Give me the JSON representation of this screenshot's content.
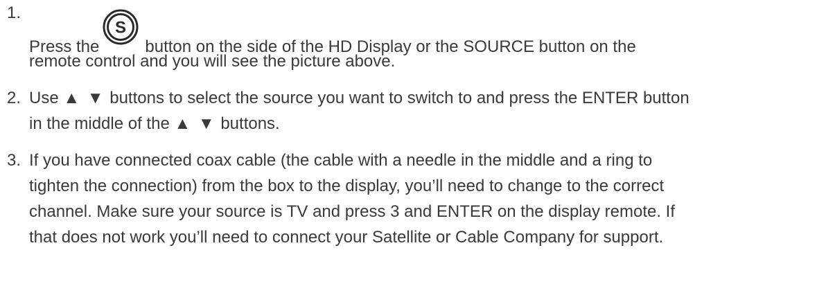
{
  "steps": [
    {
      "number": "1.",
      "line1_before": "Press the",
      "icon": "source-s-icon",
      "icon_letter": "S",
      "line1_after": "button on the side of the HD Display or the SOURCE button on the",
      "line2": "remote control and you will see the picture above."
    },
    {
      "number": "2.",
      "line1_before": "Use",
      "arrows1": "▲ ▼",
      "line1_after": "buttons to select the source you want to switch to and press the ENTER button",
      "line2_before": "in the middle of the",
      "arrows2": "▲ ▼",
      "line2_after": "buttons."
    },
    {
      "number": "3.",
      "lines": [
        "If you have connected coax cable (the cable with a needle in the middle and a ring to",
        "tighten the connection) from the box to the display, you’ll need to change to the correct",
        "channel. Make sure your source is TV and press 3 and ENTER on the display remote. If",
        "that does not work you’ll need to connect your Satellite or Cable Company for support."
      ]
    }
  ]
}
